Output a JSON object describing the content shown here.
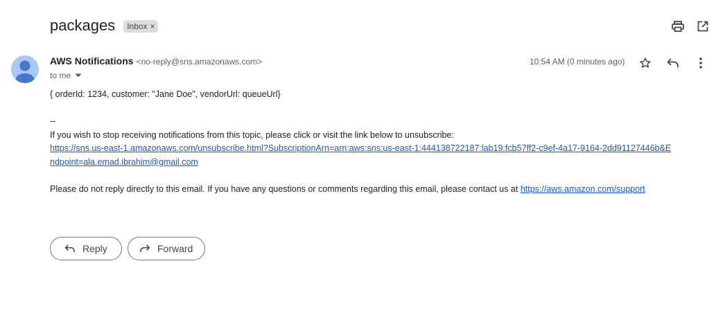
{
  "email": {
    "subject": "packages",
    "label": "Inbox",
    "label_remove": "×",
    "sender_name": "AWS Notifications",
    "sender_email": "<no-reply@sns.amazonaws.com>",
    "to": "to me",
    "timestamp": "10:54 AM (0 minutes ago)",
    "body": {
      "payload": "{ orderId: 1234, customer: \"Jane Doe\", vendorUrl: queueUrl}",
      "separator": "--",
      "unsubscribe_text": "If you wish to stop receiving notifications from this topic, please click or visit the link below to unsubscribe:",
      "unsubscribe_link": "https://sns.us-east-1.amazonaws.com/unsubscribe.html?SubscriptionArn=arn:aws:sns:us-east-1:444138722187:lab19:fcb57ff2-c9ef-4a17-9164-2dd91127446b&Endpoint=ala.emad.ibrahim@gmail.com",
      "contact_text": "Please do not reply directly to this email. If you have any questions or comments regarding this email, please contact us at ",
      "contact_link": "https://aws.amazon.com/support"
    }
  },
  "actions": {
    "reply_label": "Reply",
    "forward_label": "Forward"
  },
  "icons": {
    "print": "print-icon",
    "open_new_window": "open-in-new-window-icon",
    "star": "star-icon",
    "reply": "reply-icon",
    "more": "more-vert-icon",
    "forward": "forward-icon",
    "avatar": "person-icon",
    "dropdown": "caret-down-icon"
  },
  "colors": {
    "link": "#1a57c7",
    "avatar_bg": "#a8c7fa",
    "avatar_fg": "#4a76c9",
    "chip_bg": "#dddddd"
  }
}
